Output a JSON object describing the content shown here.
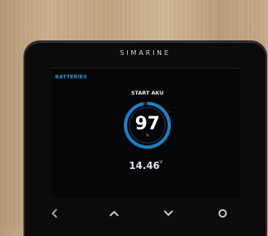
{
  "device": {
    "brand": "SIMARINE"
  },
  "screen": {
    "title": "BATTERIES",
    "battery_name": "START AKU",
    "state_of_charge": "97",
    "state_of_charge_unit": "%",
    "voltage": "14.46",
    "voltage_unit": "V"
  },
  "buttons": [
    {
      "name": "back-button",
      "icon": "chevron-left-icon"
    },
    {
      "name": "up-button",
      "icon": "chevron-up-icon"
    },
    {
      "name": "down-button",
      "icon": "chevron-down-icon"
    },
    {
      "name": "power-button",
      "icon": "circle-icon"
    }
  ],
  "colors": {
    "accent": "#2f8fd0",
    "gauge": "#1f7fc4",
    "bezel": "#0b0b0c"
  }
}
